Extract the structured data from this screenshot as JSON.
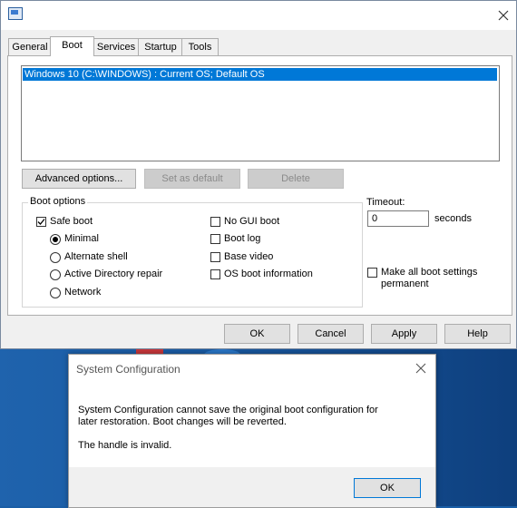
{
  "main_window": {
    "tabs": [
      "General",
      "Boot",
      "Services",
      "Startup",
      "Tools"
    ],
    "os_entries": [
      "Windows 10 (C:\\WINDOWS) : Current OS; Default OS"
    ],
    "buttons": {
      "advanced": "Advanced options...",
      "set_default": "Set as default",
      "delete": "Delete"
    },
    "boot_options": {
      "legend": "Boot options",
      "safe_boot": "Safe boot",
      "safe_boot_checked": true,
      "minimal": "Minimal",
      "alternate_shell": "Alternate shell",
      "active_directory_repair": "Active Directory repair",
      "network": "Network",
      "selected_mode": "Minimal",
      "no_gui_boot": "No GUI boot",
      "boot_log": "Boot log",
      "base_video": "Base video",
      "os_boot_information": "OS boot information"
    },
    "timeout": {
      "label": "Timeout:",
      "value": "0",
      "unit": "seconds"
    },
    "make_permanent": {
      "line1": "Make all boot settings",
      "line2": "permanent"
    },
    "footer": {
      "ok": "OK",
      "cancel": "Cancel",
      "apply": "Apply",
      "help": "Help"
    }
  },
  "dialog": {
    "title": "System Configuration",
    "message_line1": "System Configuration cannot save the original boot configuration for",
    "message_line2": "later restoration. Boot changes will be reverted.",
    "message_line3": "The handle is invalid.",
    "ok": "OK"
  },
  "colors": {
    "selection": "#0078d7",
    "desktop": "#1a5ea6"
  }
}
